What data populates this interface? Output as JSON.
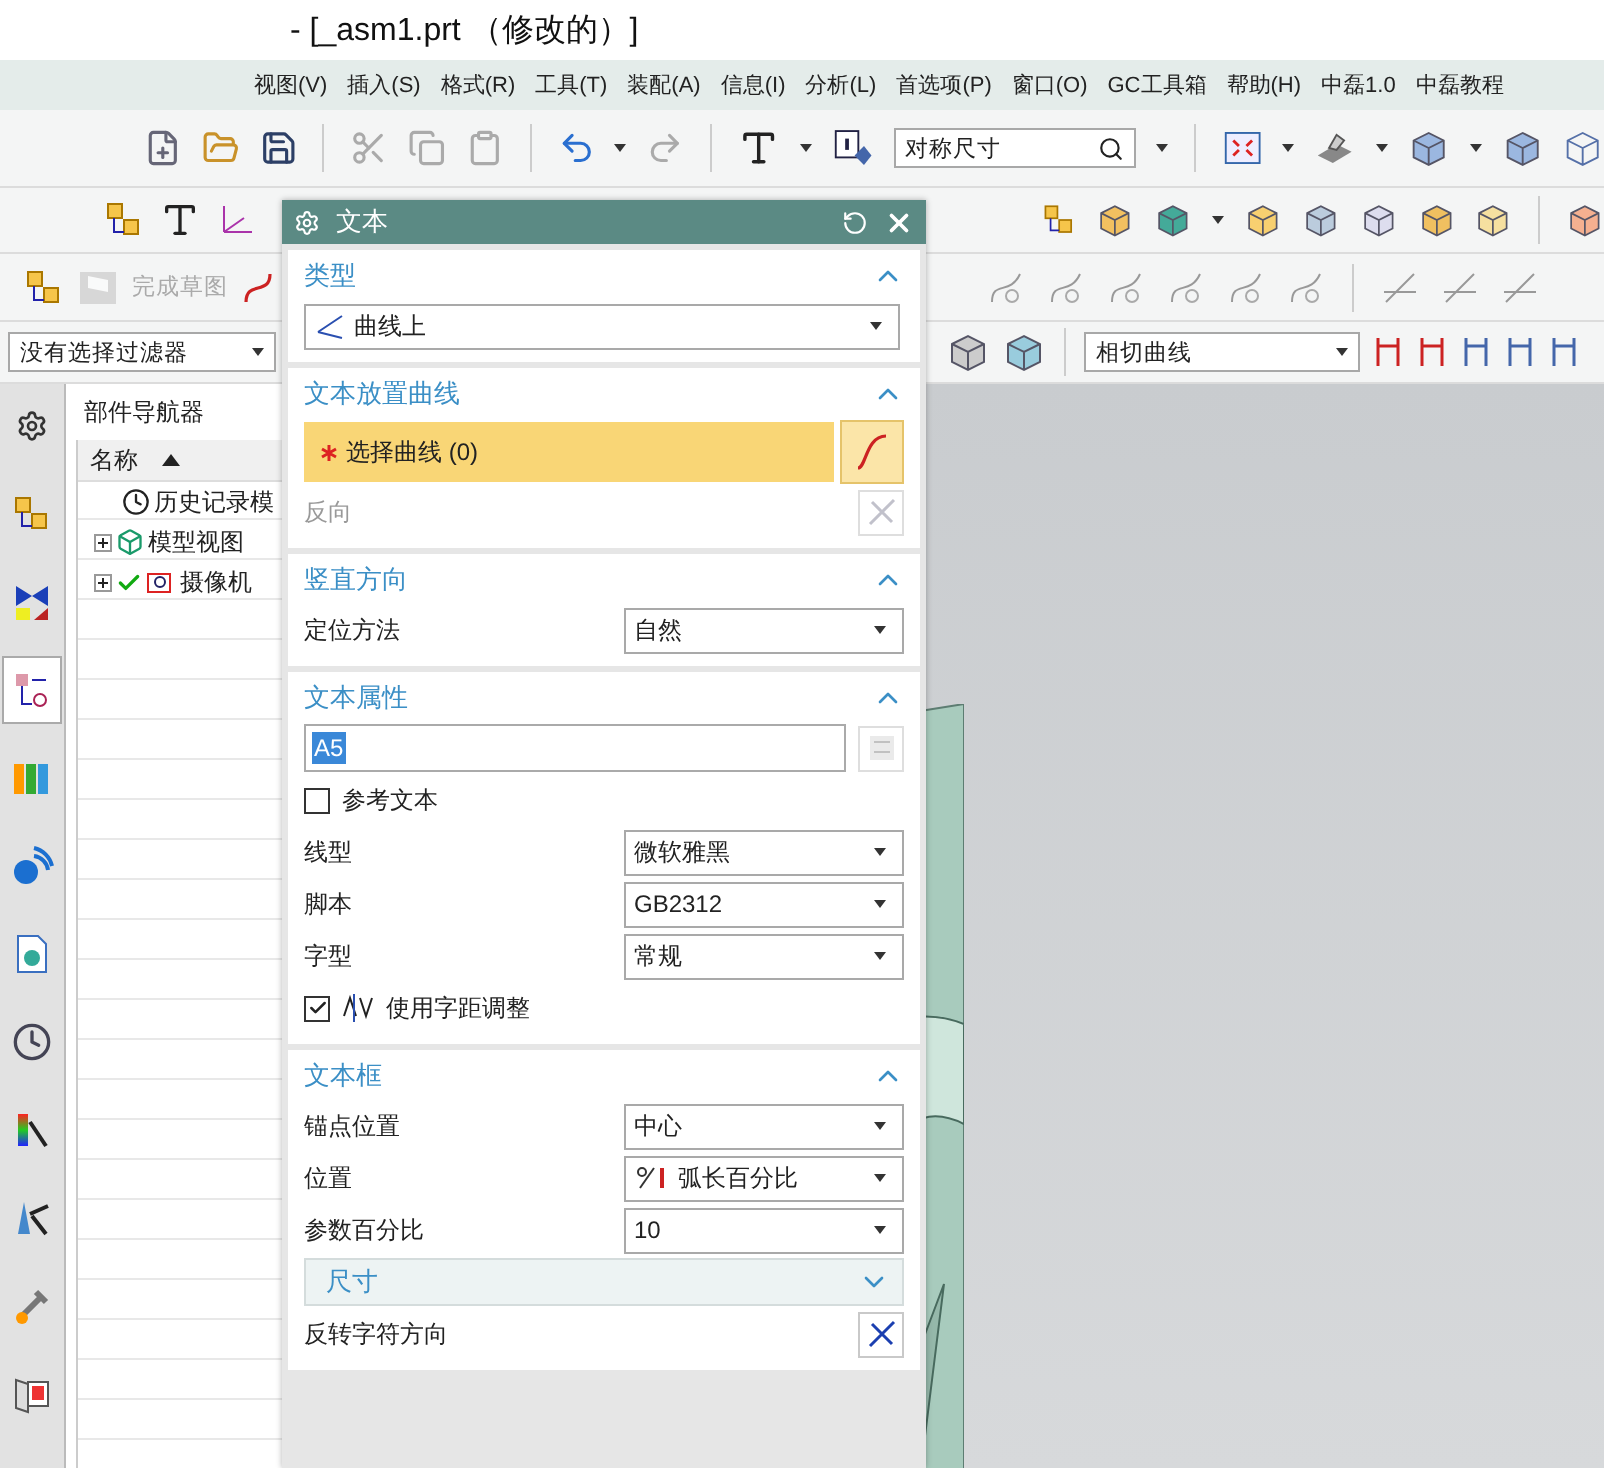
{
  "window": {
    "title": "- [_asm1.prt （修改的）]"
  },
  "menu": [
    "视图(V)",
    "插入(S)",
    "格式(R)",
    "工具(T)",
    "装配(A)",
    "信息(I)",
    "分析(L)",
    "首选项(P)",
    "窗口(O)",
    "GC工具箱",
    "帮助(H)",
    "中磊1.0",
    "中磊教程"
  ],
  "toolbar": {
    "search": {
      "value": "对称尺寸"
    },
    "finish_sketch": {
      "label": "完成草图",
      "disabled": true
    },
    "selection_filter": {
      "value": "没有选择过滤器"
    },
    "curve_rule": {
      "value": "相切曲线"
    }
  },
  "resource_bar": [
    {
      "selected": false
    },
    {
      "selected": false
    },
    {
      "selected": false
    },
    {
      "selected": true
    },
    {
      "selected": false
    },
    {
      "selected": false
    },
    {
      "selected": false
    },
    {
      "selected": false
    },
    {
      "selected": false
    },
    {
      "selected": false
    },
    {
      "selected": false
    },
    {
      "selected": false
    }
  ],
  "navigator": {
    "title": "部件导航器",
    "column": "名称",
    "tree": [
      {
        "label": "历史记录模",
        "kind": "history"
      },
      {
        "label": "模型视图",
        "kind": "views",
        "expanded": false
      },
      {
        "label": "摄像机",
        "kind": "camera",
        "expanded": false,
        "checked": true
      }
    ]
  },
  "dialog": {
    "title": "文本",
    "sections": [
      {
        "title": "类型",
        "expanded": true,
        "items": [
          {
            "kind": "type_dropdown",
            "value": "曲线上"
          }
        ]
      },
      {
        "title": "文本放置曲线",
        "expanded": true,
        "items": [
          {
            "kind": "selection",
            "label": "选择曲线 (0)",
            "required": true
          },
          {
            "kind": "action",
            "label": "反向",
            "disabled": true
          }
        ]
      },
      {
        "title": "竖直方向",
        "expanded": true,
        "items": [
          {
            "kind": "dropdown",
            "label": "定位方法",
            "value": "自然"
          }
        ]
      },
      {
        "title": "文本属性",
        "expanded": true,
        "items": [
          {
            "kind": "text_input",
            "value": "A5"
          },
          {
            "kind": "checkbox",
            "label": "参考文本",
            "checked": false
          },
          {
            "kind": "dropdown",
            "label": "线型",
            "value": "微软雅黑"
          },
          {
            "kind": "dropdown",
            "label": "脚本",
            "value": "GB2312"
          },
          {
            "kind": "dropdown",
            "label": "字型",
            "value": "常规"
          },
          {
            "kind": "checkbox",
            "label": "使用字距调整",
            "checked": true,
            "icon": true
          }
        ]
      },
      {
        "title": "文本框",
        "expanded": true,
        "items": [
          {
            "kind": "dropdown",
            "label": "锚点位置",
            "value": "中心"
          },
          {
            "kind": "dropdown",
            "label": "位置",
            "value": "弧长百分比",
            "icon": true
          },
          {
            "kind": "dropdown",
            "label": "参数百分比",
            "value": "10"
          },
          {
            "kind": "subsection",
            "label": "尺寸",
            "expanded": false
          },
          {
            "kind": "action",
            "label": "反转字符方向",
            "disabled": false
          }
        ]
      }
    ]
  }
}
